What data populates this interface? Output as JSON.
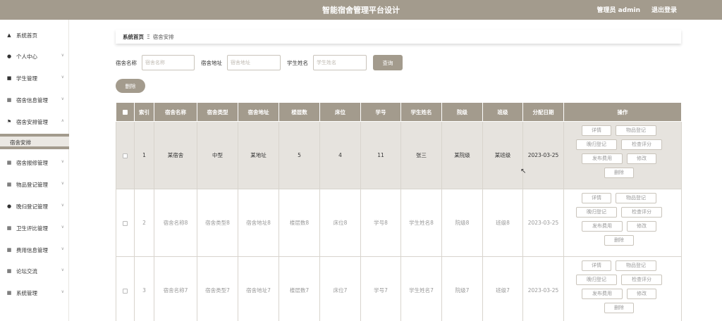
{
  "header": {
    "title": "智能宿舍管理平台设计",
    "user": "管理员 admin",
    "logout": "退出登录"
  },
  "sidebar": {
    "items": [
      {
        "label": "系统首页",
        "icon": "home-icon"
      },
      {
        "label": "个人中心",
        "icon": "user-icon"
      },
      {
        "label": "学生管理",
        "icon": "card-icon"
      },
      {
        "label": "宿舍信息管理",
        "icon": "grid-icon"
      },
      {
        "label": "宿舍安排管理",
        "icon": "flag-icon"
      },
      {
        "label": "宿舍报修管理",
        "icon": "grid-icon"
      },
      {
        "label": "物品登记管理",
        "icon": "grid-icon"
      },
      {
        "label": "晚归登记管理",
        "icon": "user-icon"
      },
      {
        "label": "卫生评比管理",
        "icon": "grid-icon"
      },
      {
        "label": "费用信息管理",
        "icon": "grid-icon"
      },
      {
        "label": "论坛交流",
        "icon": "grid-icon"
      },
      {
        "label": "系统管理",
        "icon": "grid-icon"
      }
    ],
    "submenu_active": "宿舍安排"
  },
  "breadcrumb": {
    "home": "系统首页",
    "separator": "Ξ",
    "current": "宿舍安排"
  },
  "search": {
    "dorm_name_label": "宿舍名称",
    "dorm_name_placeholder": "宿舍名称",
    "dorm_addr_label": "宿舍地址",
    "dorm_addr_placeholder": "宿舍地址",
    "student_name_label": "学生姓名",
    "student_name_placeholder": "学生姓名",
    "query_button": "查询"
  },
  "delete_button": "删除",
  "table": {
    "columns": [
      "索引",
      "宿舍名称",
      "宿舍类型",
      "宿舍地址",
      "楼层数",
      "床位",
      "学号",
      "学生姓名",
      "院级",
      "班级",
      "分配日期",
      "操作"
    ],
    "rows": [
      {
        "index": "1",
        "name": "某宿舍",
        "type": "中型",
        "address": "某地址",
        "floors": "5",
        "bed": "4",
        "student_no": "11",
        "student_name": "张三",
        "college": "某院级",
        "class": "某班级",
        "date": "2023-03-25"
      },
      {
        "index": "2",
        "name": "宿舍名称8",
        "type": "宿舍类型8",
        "address": "宿舍地址8",
        "floors": "楼层数8",
        "bed": "床位8",
        "student_no": "学号8",
        "student_name": "学生姓名8",
        "college": "院级8",
        "class": "班级8",
        "date": "2023-03-25"
      },
      {
        "index": "3",
        "name": "宿舍名称7",
        "type": "宿舍类型7",
        "address": "宿舍地址7",
        "floors": "楼层数7",
        "bed": "床位7",
        "student_no": "学号7",
        "student_name": "学生姓名7",
        "college": "院级7",
        "class": "班级7",
        "date": "2023-03-25"
      }
    ],
    "actions": {
      "detail": "详情",
      "item_register": "物品登记",
      "late_register": "晚归登记",
      "hygiene": "检查评分",
      "publish_fee": "发布费用",
      "edit": "修改",
      "delete": "删除"
    }
  },
  "colors": {
    "accent": "#a39b8d",
    "row_highlight": "#e6e3de"
  }
}
